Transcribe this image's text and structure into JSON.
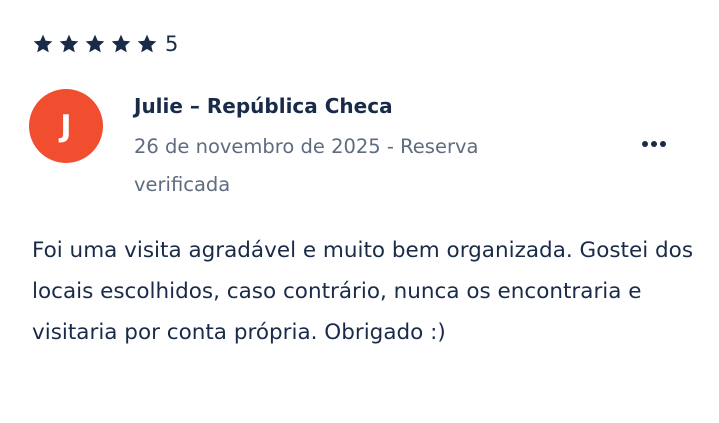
{
  "review": {
    "rating_value": "5",
    "rating_fraction": 1.0,
    "star_count": 5,
    "star_icon": "star-icon",
    "avatar_initial": "J",
    "avatar_color": "#f04e2f",
    "reviewer_line": "Julie – República Checa",
    "meta_line": "26 de novembro de 2025 - Reserva verificada",
    "more_icon": "more-dots-icon",
    "text": "Foi uma visita agradável e muito bem organizada. Gostei dos locais escolhidos, caso contrário, nunca os encontraria e visitaria por conta própria. Obrigado :)"
  },
  "colors": {
    "primary_text": "#1a2b49",
    "secondary_text": "#5f6b80",
    "star": "#1a2b49"
  }
}
